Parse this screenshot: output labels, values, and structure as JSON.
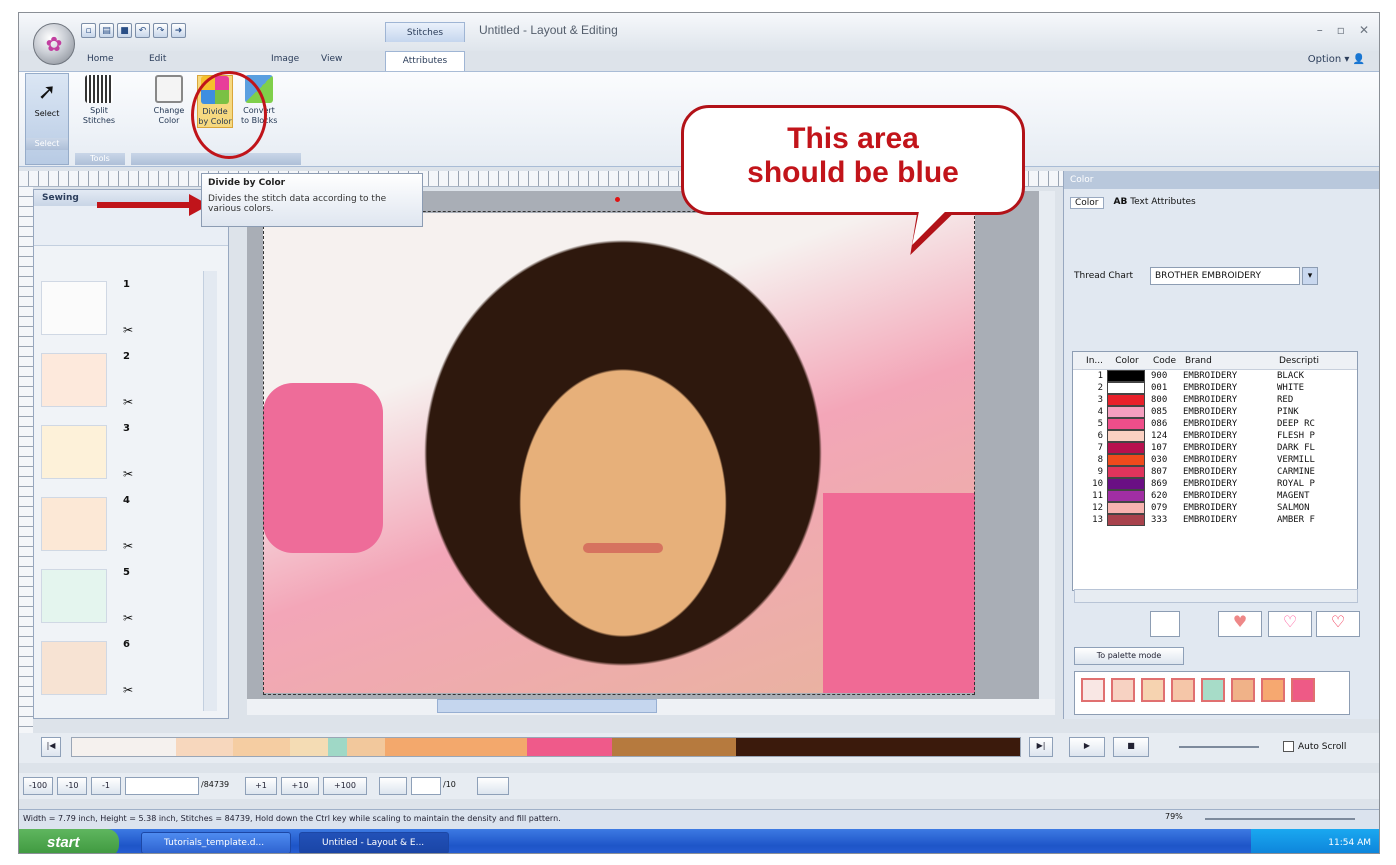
{
  "window": {
    "title": "Untitled - Layout & Editing",
    "context_tab": "Stitches",
    "option_label": "Option"
  },
  "ribbon": {
    "tabs": [
      "Home",
      "Edit",
      "Image",
      "View"
    ],
    "active_tab": "Attributes",
    "buttons": {
      "select": "Select",
      "split": "Split\nStitches",
      "change": "Change\nColor",
      "divide": "Divide\nby Color",
      "convert": "Convert\nto Blocks"
    },
    "groups": {
      "select": "Select",
      "tools": "Tools"
    }
  },
  "tooltip": {
    "title": "Divide by Color",
    "body": "Divides the stitch data according to the various colors."
  },
  "callout": {
    "line1": "This area",
    "line2": "should be blue"
  },
  "sewing_panel": {
    "title": "Sewing",
    "items": [
      "1",
      "2",
      "3",
      "4",
      "5",
      "6"
    ]
  },
  "color_panel": {
    "title": "Color",
    "tabs": [
      "Color",
      "Text Attributes"
    ],
    "thread_chart_label": "Thread Chart",
    "thread_chart_value": "BROTHER EMBROIDERY",
    "columns": [
      "In...",
      "Color",
      "Code",
      "Brand",
      "Descripti"
    ],
    "rows": [
      {
        "n": "1",
        "color": "#000000",
        "code": "900",
        "brand": "EMBROIDERY",
        "desc": "BLACK"
      },
      {
        "n": "2",
        "color": "#ffffff",
        "code": "001",
        "brand": "EMBROIDERY",
        "desc": "WHITE"
      },
      {
        "n": "3",
        "color": "#e8202a",
        "code": "800",
        "brand": "EMBROIDERY",
        "desc": "RED"
      },
      {
        "n": "4",
        "color": "#f59fc0",
        "code": "085",
        "brand": "EMBROIDERY",
        "desc": "PINK"
      },
      {
        "n": "5",
        "color": "#ef4e8a",
        "code": "086",
        "brand": "EMBROIDERY",
        "desc": "DEEP RC"
      },
      {
        "n": "6",
        "color": "#fbd0c2",
        "code": "124",
        "brand": "EMBROIDERY",
        "desc": "FLESH P"
      },
      {
        "n": "7",
        "color": "#b8104e",
        "code": "107",
        "brand": "EMBROIDERY",
        "desc": "DARK FL"
      },
      {
        "n": "8",
        "color": "#f04a1c",
        "code": "030",
        "brand": "EMBROIDERY",
        "desc": "VERMILL"
      },
      {
        "n": "9",
        "color": "#e0345c",
        "code": "807",
        "brand": "EMBROIDERY",
        "desc": "CARMINE"
      },
      {
        "n": "10",
        "color": "#6a0f84",
        "code": "869",
        "brand": "EMBROIDERY",
        "desc": "ROYAL P"
      },
      {
        "n": "11",
        "color": "#a12ea4",
        "code": "620",
        "brand": "EMBROIDERY",
        "desc": "MAGENT"
      },
      {
        "n": "12",
        "color": "#f7b3b0",
        "code": "079",
        "brand": "EMBROIDERY",
        "desc": "SALMON"
      },
      {
        "n": "13",
        "color": "#a8424c",
        "code": "333",
        "brand": "EMBROIDERY",
        "desc": "AMBER F"
      }
    ],
    "palette_mode_label": "To palette mode",
    "palette": [
      "#f9e7e4",
      "#f7d2c2",
      "#f6d3b0",
      "#f5c6a8",
      "#a7dcc8",
      "#f0b288",
      "#f6a870",
      "#ee5a86"
    ]
  },
  "timeline": {
    "segments": [
      {
        "color": "#f5f1ee",
        "w": 0.11
      },
      {
        "color": "#f7d7bd",
        "w": 0.06
      },
      {
        "color": "#f5cda2",
        "w": 0.06
      },
      {
        "color": "#f4dcb4",
        "w": 0.04
      },
      {
        "color": "#9fd8c6",
        "w": 0.02
      },
      {
        "color": "#f2c89c",
        "w": 0.04
      },
      {
        "color": "#f3a86c",
        "w": 0.15
      },
      {
        "color": "#ef5a8a",
        "w": 0.09
      },
      {
        "color": "#b67a3e",
        "w": 0.13
      },
      {
        "color": "#3b1a0c",
        "w": 0.3
      }
    ],
    "auto_scroll": "Auto Scroll"
  },
  "controls": {
    "m100": "-100",
    "m10": "-10",
    "m1": "-1",
    "total": "/84739",
    "p1": "+1",
    "p10": "+10",
    "p100": "+100",
    "frame": "/10"
  },
  "status": {
    "text": "Width = 7.79 inch, Height = 5.38 inch, Stitches = 84739, Hold down the Ctrl key while scaling to maintain the density and fill pattern.",
    "zoom": "79%"
  },
  "taskbar": {
    "start": "start",
    "items": [
      "Tutorials_template.d...",
      "Untitled - Layout & E..."
    ],
    "clock": "11:54 AM"
  }
}
